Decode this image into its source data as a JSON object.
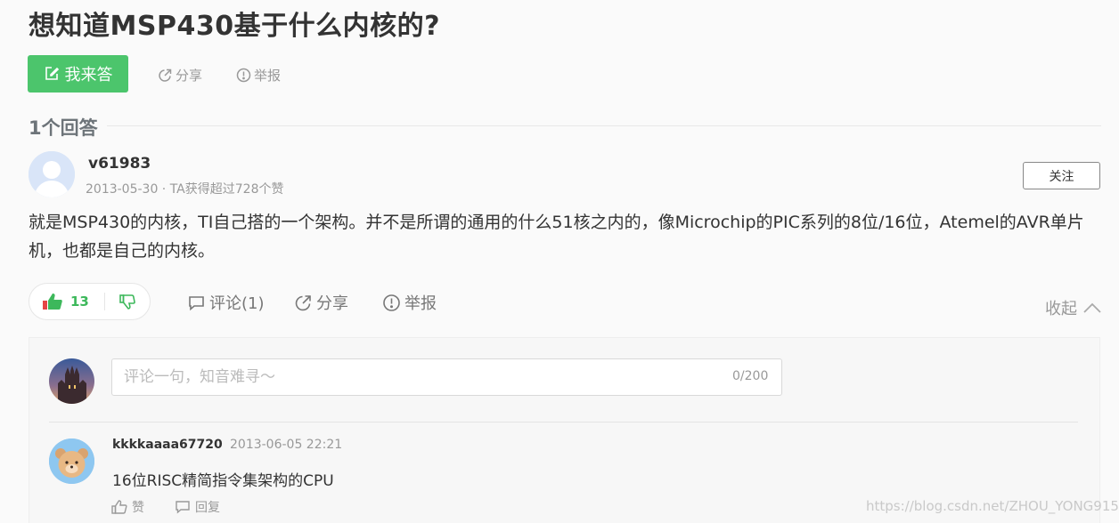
{
  "question": {
    "title": "想知道MSP430基于什么内核的?",
    "answer_button": "我来答",
    "share": "分享",
    "report": "举报"
  },
  "answers_header": "1个回答",
  "answer": {
    "username": "v61983",
    "meta": "2013-05-30 · TA获得超过728个赞",
    "follow": "关注",
    "body": "就是MSP430的内核，TI自己搭的一个架构。并不是所谓的通用的什么51核之内的，像Microchip的PIC系列的8位/16位，Atemel的AVR单片机，也都是自己的内核。",
    "likes": "13",
    "comment": "评论(1)",
    "share": "分享",
    "report": "举报",
    "collapse": "收起"
  },
  "comment_form": {
    "placeholder": "评论一句，知音难寻～",
    "counter": "0/200"
  },
  "comment": {
    "username": "kkkkaaaa67720",
    "time": "2013-06-05 22:21",
    "text": "16位RISC精简指令集架构的CPU",
    "like": "赞",
    "reply": "回复"
  },
  "watermark": "https://blog.csdn.net/ZHOU_YONG915",
  "colors": {
    "accent_green": "#4cc56c",
    "like_green": "#3db85b"
  }
}
